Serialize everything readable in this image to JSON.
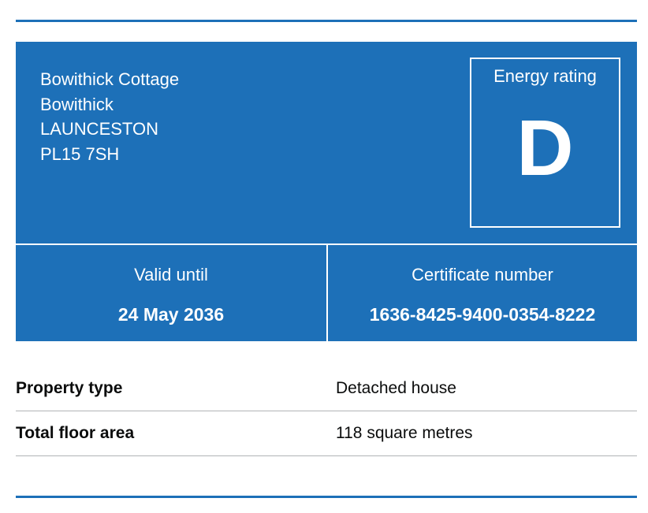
{
  "address": {
    "line1": "Bowithick Cottage",
    "line2": "Bowithick",
    "line3": "LAUNCESTON",
    "postcode": "PL15 7SH"
  },
  "rating": {
    "label": "Energy rating",
    "letter": "D"
  },
  "validity": {
    "label": "Valid until",
    "value": "24 May 2036"
  },
  "certificate": {
    "label": "Certificate number",
    "value": "1636-8425-9400-0354-8222"
  },
  "summary": {
    "rows": [
      {
        "key": "Property type",
        "value": "Detached house"
      },
      {
        "key": "Total floor area",
        "value": "118 square metres"
      }
    ]
  },
  "colors": {
    "panel_blue": "#1d70b8",
    "text_dark": "#0b0c0c",
    "divider_grey": "#b1b4b6"
  }
}
